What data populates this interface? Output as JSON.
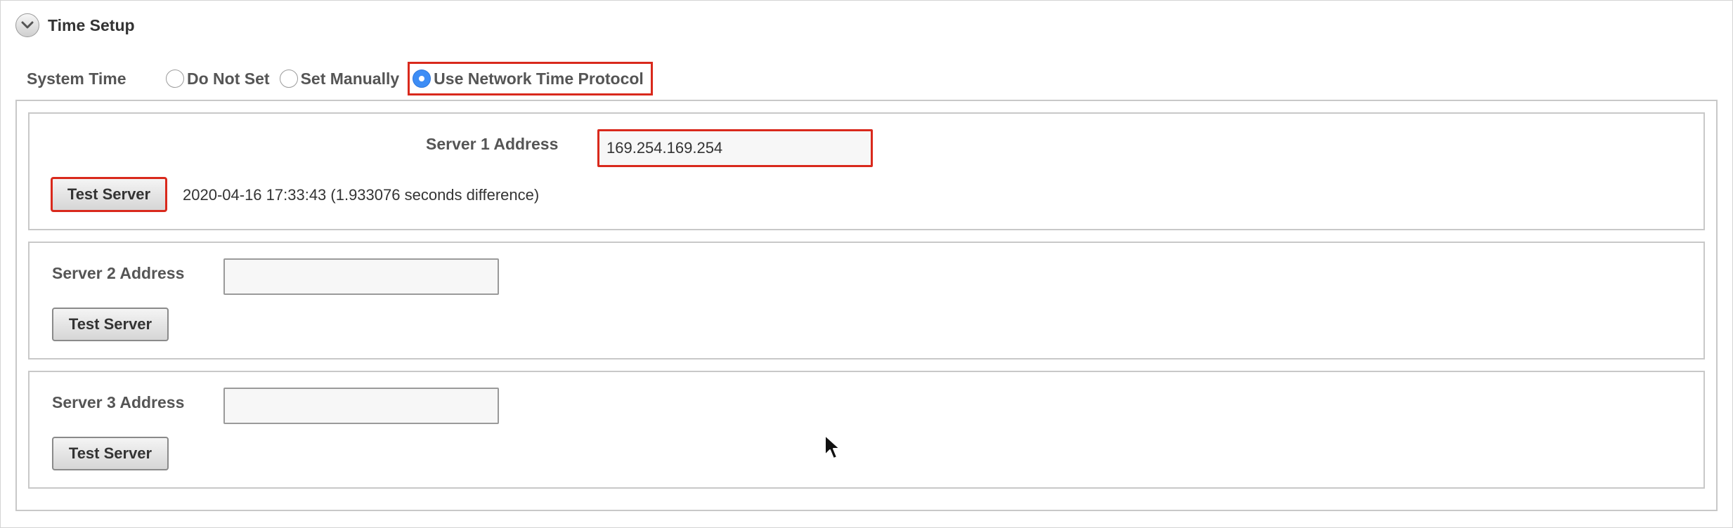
{
  "section": {
    "title": "Time Setup",
    "toggle_icon": "chevron-down-icon"
  },
  "system_time": {
    "label": "System Time",
    "options": [
      {
        "label": "Do Not Set",
        "selected": false
      },
      {
        "label": "Set Manually",
        "selected": false
      },
      {
        "label": "Use Network Time Protocol",
        "selected": true
      }
    ]
  },
  "servers": [
    {
      "label": "Server 1 Address",
      "value": "169.254.169.254",
      "button_label": "Test Server",
      "result": "2020-04-16 17:33:43 (1.933076 seconds difference)"
    },
    {
      "label": "Server 2 Address",
      "value": "",
      "button_label": "Test Server"
    },
    {
      "label": "Server 3 Address",
      "value": "",
      "button_label": "Test Server"
    }
  ],
  "colors": {
    "highlight": "#d9291c",
    "radio_selected": "#3d8df5"
  }
}
